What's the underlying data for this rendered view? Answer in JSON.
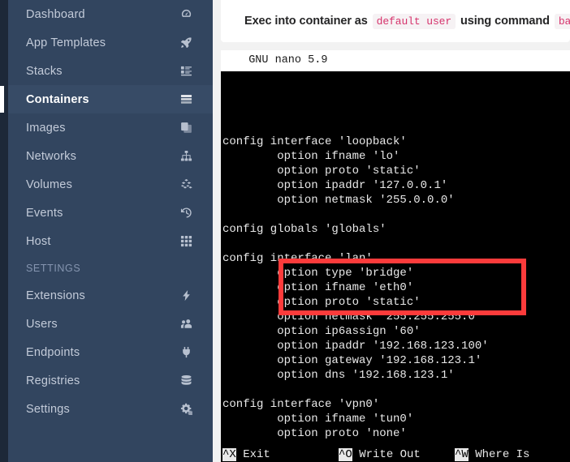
{
  "sidebar": {
    "items": [
      {
        "label": "Dashboard",
        "icon": "dashboard-icon",
        "name": "sidebar-item-dashboard",
        "active": false,
        "type": "item"
      },
      {
        "label": "App Templates",
        "icon": "rocket-icon",
        "name": "sidebar-item-app-templates",
        "active": false,
        "type": "item"
      },
      {
        "label": "Stacks",
        "icon": "list-icon",
        "name": "sidebar-item-stacks",
        "active": false,
        "type": "item"
      },
      {
        "label": "Containers",
        "icon": "containers-icon",
        "name": "sidebar-item-containers",
        "active": true,
        "type": "item"
      },
      {
        "label": "Images",
        "icon": "copy-icon",
        "name": "sidebar-item-images",
        "active": false,
        "type": "item"
      },
      {
        "label": "Networks",
        "icon": "sitemap-icon",
        "name": "sidebar-item-networks",
        "active": false,
        "type": "item"
      },
      {
        "label": "Volumes",
        "icon": "cubes-icon",
        "name": "sidebar-item-volumes",
        "active": false,
        "type": "item"
      },
      {
        "label": "Events",
        "icon": "history-icon",
        "name": "sidebar-item-events",
        "active": false,
        "type": "item"
      },
      {
        "label": "Host",
        "icon": "grid-icon",
        "name": "sidebar-item-host",
        "active": false,
        "type": "item"
      },
      {
        "label": "SETTINGS",
        "icon": "",
        "name": "sidebar-section-settings",
        "active": false,
        "type": "section"
      },
      {
        "label": "Extensions",
        "icon": "bolt-icon",
        "name": "sidebar-item-extensions",
        "active": false,
        "type": "item"
      },
      {
        "label": "Users",
        "icon": "users-icon",
        "name": "sidebar-item-users",
        "active": false,
        "type": "item"
      },
      {
        "label": "Endpoints",
        "icon": "plug-icon",
        "name": "sidebar-item-endpoints",
        "active": false,
        "type": "item"
      },
      {
        "label": "Registries",
        "icon": "database-icon",
        "name": "sidebar-item-registries",
        "active": false,
        "type": "item"
      },
      {
        "label": "Settings",
        "icon": "cogs-icon",
        "name": "sidebar-item-settings",
        "active": false,
        "type": "item"
      }
    ]
  },
  "exec_header": {
    "text_1": "Exec into container as ",
    "code_1": "default user",
    "text_2": " using command ",
    "code_2": "bash"
  },
  "terminal": {
    "nano_title": "  GNU nano 5.9",
    "lines": [
      "",
      "config interface 'loopback'",
      "        option ifname 'lo'",
      "        option proto 'static'",
      "        option ipaddr '127.0.0.1'",
      "        option netmask '255.0.0.0'",
      "",
      "config globals 'globals'",
      "",
      "config interface 'lan'",
      "        option type 'bridge'",
      "        option ifname 'eth0'",
      "        option proto 'static'",
      "        option netmask '255.255.255.0'",
      "        option ip6assign '60'",
      "        option ipaddr '192.168.123.100'",
      "        option gateway '192.168.123.1'",
      "        option dns '192.168.123.1'",
      "",
      "config interface 'vpn0'",
      "        option ifname 'tun0'",
      "        option proto 'none'"
    ],
    "shortcuts": [
      {
        "key": "^X",
        "label": " Exit"
      },
      {
        "key": "^O",
        "label": " Write Out"
      },
      {
        "key": "^W",
        "label": " Where Is"
      }
    ],
    "highlight_note": "red annotation box around ip6assign / ipaddr / gateway / dns lines"
  },
  "colors": {
    "sidebar_bg": "#32455f",
    "sidebar_gutter": "#1d2838",
    "sidebar_active_bg": "#374b66",
    "sidebar_text": "#c3cbd9",
    "accent_red": "#fc3b3b",
    "code_text": "#d6336c",
    "terminal_bg": "#000000",
    "terminal_text": "#e9e9e9",
    "page_bg": "#f2f2f2"
  }
}
